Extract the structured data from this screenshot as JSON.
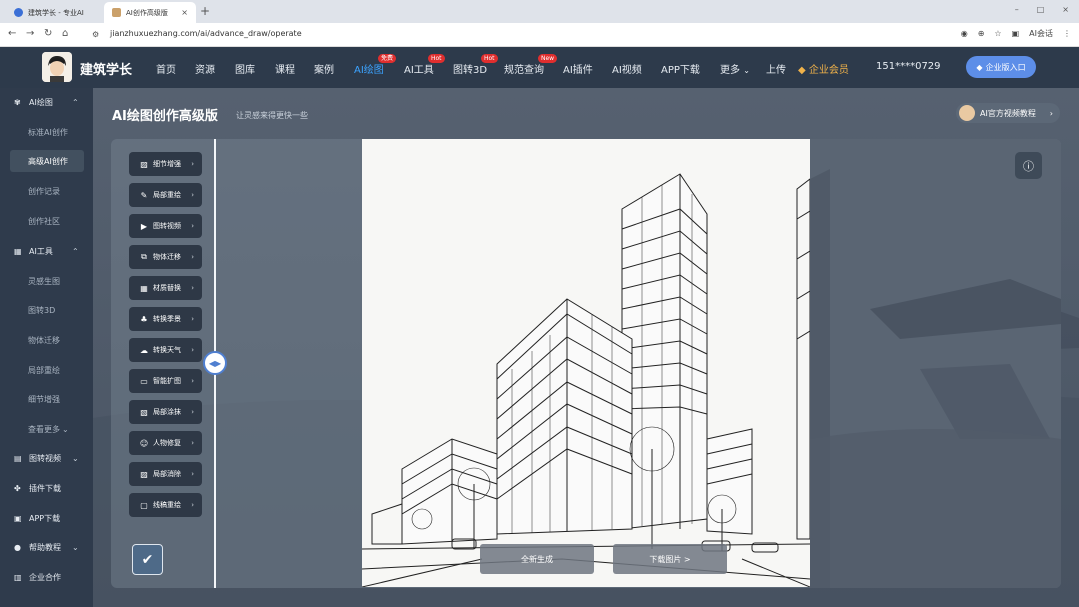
{
  "browser": {
    "tabs": [
      {
        "title": "建筑学长 - 专业AI"
      },
      {
        "title": "AI创作高级版"
      }
    ],
    "url": "jianzhuxuezhang.com/ai/advance_draw/operate",
    "profile_label": "AI会话",
    "win_min": "–",
    "win_max": "□",
    "win_close": "×"
  },
  "header": {
    "site_name": "建筑学长",
    "menu": [
      {
        "label": "首页"
      },
      {
        "label": "资源"
      },
      {
        "label": "图库"
      },
      {
        "label": "课程"
      },
      {
        "label": "案例"
      },
      {
        "label": "AI绘图",
        "badge": "免费",
        "active": true
      },
      {
        "label": "AI工具",
        "badge": "Hot"
      },
      {
        "label": "图转3D",
        "badge": "Hot"
      },
      {
        "label": "规范查询",
        "badge": "New"
      },
      {
        "label": "AI插件"
      },
      {
        "label": "AI视频"
      },
      {
        "label": "APP下载"
      },
      {
        "label": "更多"
      },
      {
        "label": "上传"
      },
      {
        "label": "企业会员"
      }
    ],
    "phone": "151****0729",
    "enterprise_btn": "企业版入口"
  },
  "sidebar": {
    "groups": [
      {
        "label": "AI绘图",
        "icon": "palette-icon",
        "items": [
          "标准AI创作",
          "高级AI创作",
          "创作记录",
          "创作社区"
        ]
      },
      {
        "label": "AI工具",
        "icon": "toolbox-icon",
        "items": [
          "灵感生图",
          "图转3D",
          "物体迁移",
          "局部重绘",
          "细节增强",
          "查看更多"
        ]
      },
      {
        "label": "图转视频",
        "icon": "video-icon"
      },
      {
        "label": "插件下载",
        "icon": "puzzle-icon"
      },
      {
        "label": "APP下载",
        "icon": "app-icon"
      },
      {
        "label": "帮助教程",
        "icon": "help-icon"
      },
      {
        "label": "企业合作",
        "icon": "building-icon"
      }
    ]
  },
  "page": {
    "title": "AI绘图创作高级版",
    "subtitle": "让灵感来得更快一些",
    "tutorial": "AI官方视频教程"
  },
  "tools": [
    {
      "label": "细节增强",
      "icon": "image-enhance-icon"
    },
    {
      "label": "局部重绘",
      "icon": "brush-icon"
    },
    {
      "label": "图转视频",
      "icon": "video-icon"
    },
    {
      "label": "物体迁移",
      "icon": "move-icon"
    },
    {
      "label": "材质替换",
      "icon": "material-icon"
    },
    {
      "label": "转换季景",
      "icon": "season-icon"
    },
    {
      "label": "转换天气",
      "icon": "weather-icon"
    },
    {
      "label": "智能扩图",
      "icon": "expand-icon"
    },
    {
      "label": "局部涂抹",
      "icon": "eraser-icon"
    },
    {
      "label": "人物修复",
      "icon": "person-icon"
    },
    {
      "label": "局部消除",
      "icon": "remove-icon"
    },
    {
      "label": "线稿重绘",
      "icon": "lineart-icon"
    }
  ],
  "actions": {
    "regenerate": "全新生成",
    "download": "下载图片 >"
  },
  "colors": {
    "header_bg": "#2d3a4b",
    "accent": "#3ca3ff",
    "badge": "#e02e2e",
    "member": "#f0b24a"
  }
}
